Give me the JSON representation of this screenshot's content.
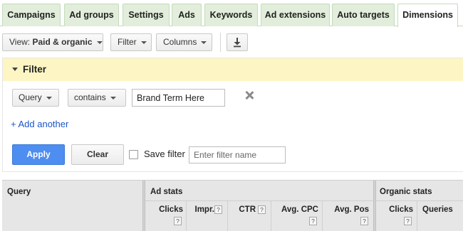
{
  "tabs": [
    {
      "label": "Campaigns"
    },
    {
      "label": "Ad groups"
    },
    {
      "label": "Settings"
    },
    {
      "label": "Ads"
    },
    {
      "label": "Keywords"
    },
    {
      "label": "Ad extensions"
    },
    {
      "label": "Auto targets"
    },
    {
      "label": "Dimensions",
      "active": true
    }
  ],
  "toolbar": {
    "view_prefix": "View: ",
    "view_value": "Paid & organic",
    "filter_label": "Filter",
    "columns_label": "Columns",
    "download_icon": "download-icon"
  },
  "filter": {
    "title": "Filter",
    "field_select": "Query",
    "operator_select": "contains",
    "value": "Brand Term Here",
    "remove_icon": "close-icon",
    "add_another": "+ Add another",
    "apply_label": "Apply",
    "clear_label": "Clear",
    "save_filter_label": "Save filter",
    "filter_name_placeholder": "Enter filter name"
  },
  "table": {
    "query_header": "Query",
    "ad_stats_header": "Ad stats",
    "organic_stats_header": "Organic stats",
    "help_glyph": "?",
    "ad_columns": [
      "Clicks",
      "Impr.",
      "CTR",
      "Avg. CPC",
      "Avg. Pos"
    ],
    "organic_columns": [
      "Clicks",
      "Queries"
    ]
  },
  "colors": {
    "tab_bg": "#e2eedb",
    "filter_header_bg": "#fdf6c4",
    "apply_blue": "#4d8ef0",
    "link_blue": "#1a55c9"
  }
}
